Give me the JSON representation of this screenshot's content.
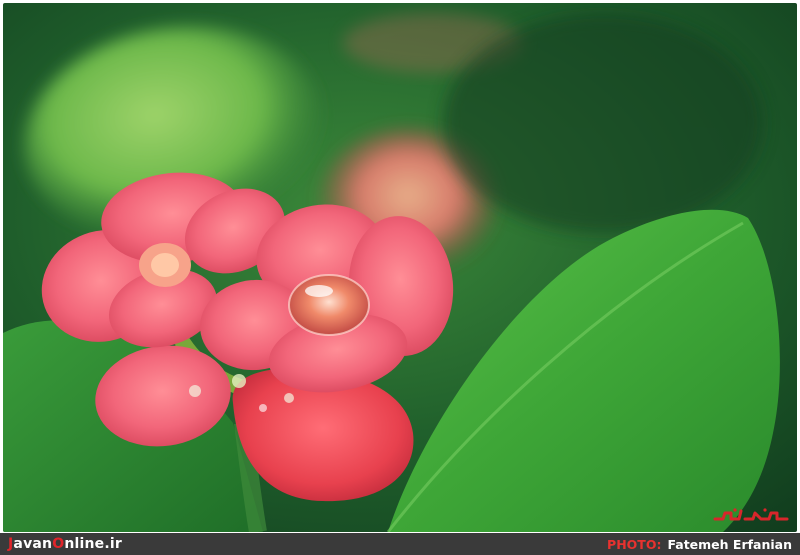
{
  "footer": {
    "site_part1": "J",
    "site_part2": "avan",
    "site_part3": "O",
    "site_part4": "nline.ir",
    "photo_label": "PHOTO:",
    "photographer": "Fatemeh Erfanian"
  },
  "colors": {
    "footer_bg": "#3a3a3a",
    "brand_red": "#e0242a",
    "leaf_green": "#3fae3a",
    "petal_pink": "#f06a78"
  },
  "icons": {
    "watermark": "javan-logo-watermark"
  }
}
